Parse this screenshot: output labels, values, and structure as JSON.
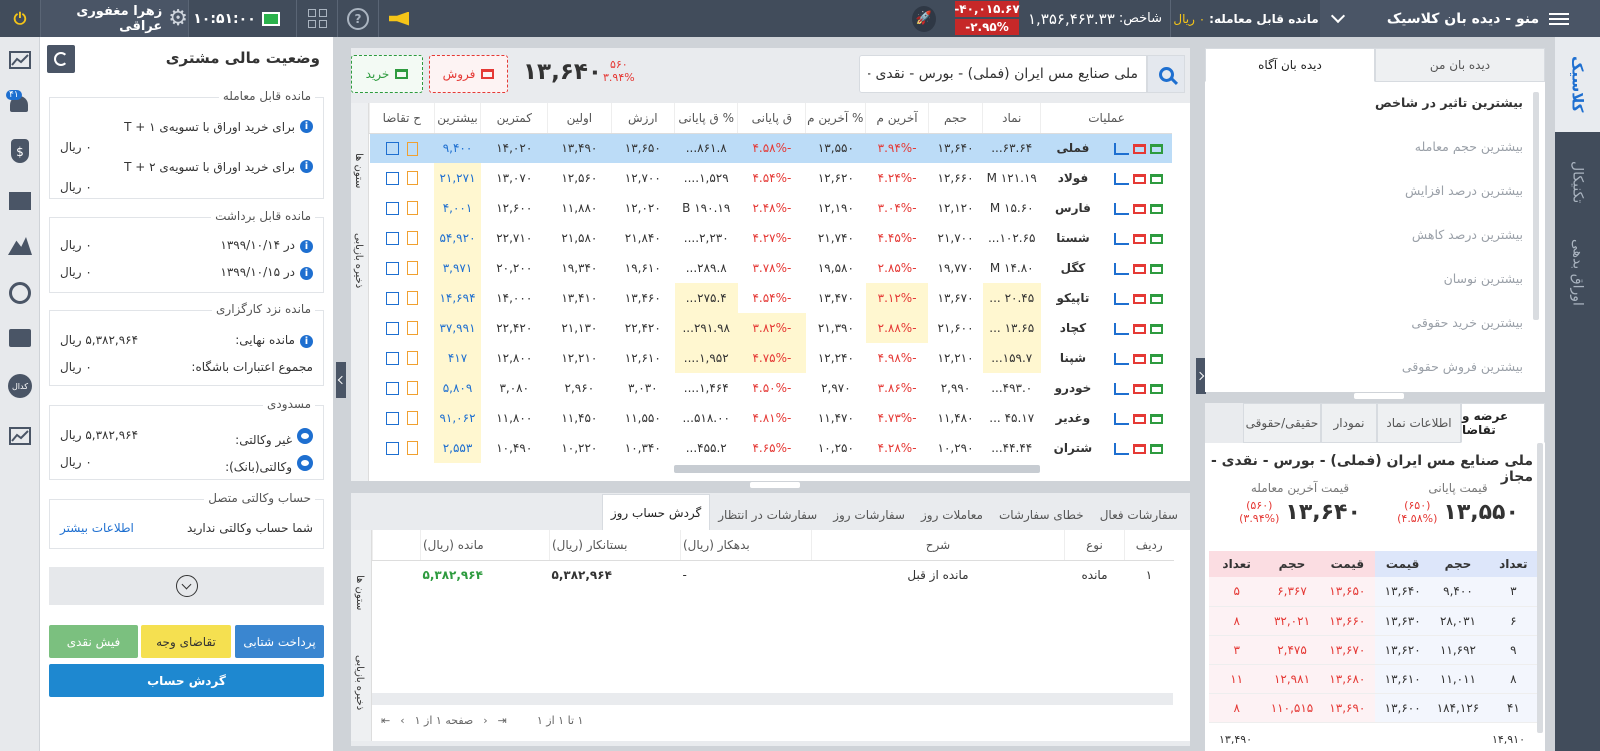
{
  "top": {
    "menu_title": "منو - دیده بان کلاسیک",
    "balance_label": "مانده قابل معامله:",
    "balance_value": "۰ ریال",
    "index_label": "شاخص:",
    "index_value": "۱,۳۵۶,۴۶۳.۳۳",
    "index_change": "-۴۰,۰۱۵.۶۷",
    "index_pct": "-۲.۹۵%",
    "time": "۱۰:۵۱:۰۰",
    "user": "زهرا مغفوری عراقی"
  },
  "right_tabs": [
    "کلاسیک",
    "تکنیکال",
    "اوراق بدهی"
  ],
  "watch": {
    "tabs": [
      "دیده بان من",
      "دیده بان آگاه"
    ],
    "items": [
      "بیشترین تاثیر در شاخص",
      "بیشترین حجم معامله",
      "بیشترین درصد افزایش",
      "بیشترین درصد کاهش",
      "بیشترین نوسان",
      "بیشترین خرید حقوقی",
      "بیشترین فروش حقوقی"
    ]
  },
  "ob": {
    "tabs": [
      "عرضه و تقاضا",
      "اطلاعات نماد",
      "نمودار",
      "حقیقی/حقوقی"
    ],
    "title": "ملی صنایع مس ایران (فملی) - بورس - نقدی - مجاز",
    "last_label": "قیمت آخرین معامله",
    "last_price": "۱۳,۶۴۰",
    "last_change": "(۵۶۰)",
    "last_pct": "(۳.۹۴%)",
    "close_label": "قیمت پایانی",
    "close_price": "۱۳,۵۵۰",
    "close_change": "(۶۵۰)",
    "close_pct": "(۴.۵۸%)",
    "headers": [
      "تعداد",
      "حجم",
      "قیمت",
      "قیمت",
      "حجم",
      "تعداد"
    ],
    "rows": [
      [
        "۳",
        "۹,۴۰۰",
        "۱۳,۶۴۰",
        "۱۳,۶۵۰",
        "۶,۳۶۷",
        "۵"
      ],
      [
        "۶",
        "۲۸,۰۳۱",
        "۱۳,۶۳۰",
        "۱۳,۶۶۰",
        "۳۲,۰۲۱",
        "۸"
      ],
      [
        "۹",
        "۱۱,۶۹۲",
        "۱۳,۶۲۰",
        "۱۳,۶۷۰",
        "۲,۴۷۵",
        "۳"
      ],
      [
        "۸",
        "۱۱,۰۱۱",
        "۱۳,۶۱۰",
        "۱۳,۶۸۰",
        "۱۲,۹۸۱",
        "۱۱"
      ],
      [
        "۴۱",
        "۱۸۴,۱۲۶",
        "۱۳,۶۰۰",
        "۱۳,۶۹۰",
        "۱۱۰,۵۱۵",
        "۸"
      ]
    ],
    "footer_left": "۱۳,۴۹۰",
    "footer_right": "۱۴,۹۱۰"
  },
  "center": {
    "search_value": "ملی صنایع مس ایران (فملی) - بورس - نقدی - مجاز",
    "price": "۱۳,۶۴۰",
    "change": "۵۶۰",
    "pct": "۳.۹۴%",
    "sell": "فروش",
    "buy": "خرید",
    "headers": [
      "عملیات",
      "نماد",
      "حجم",
      "آخرین م",
      "% آخرین م",
      "ق پایانی",
      "% ق پایانی",
      "ارزش",
      "اولین",
      "کمترین",
      "بیشترین",
      "ح تقاضا"
    ],
    "side_labels": [
      "ستون ها",
      "ذخیره بازیابی"
    ],
    "rows": [
      [
        "فملی",
        "۶۳.۶۴...",
        "۱۳,۶۴۰",
        "-۳.۹۴%",
        "۱۳,۵۵۰",
        "-۴.۵۸%",
        "۸۶۱.۸...",
        "۱۳,۶۵۰",
        "۱۳,۴۹۰",
        "۱۴,۰۲۰",
        "۹,۴۰۰"
      ],
      [
        "فولاد",
        "۱۲۱.۱۹ M",
        "۱۲,۶۶۰",
        "-۴.۲۴%",
        "۱۲,۶۲۰",
        "-۴.۵۴%",
        "۱,۵۲۹....",
        "۱۲,۷۰۰",
        "۱۲,۵۶۰",
        "۱۳,۰۷۰",
        "۲۱,۲۷۱"
      ],
      [
        "فارس",
        "۱۵.۶۰ M",
        "۱۲,۱۲۰",
        "-۳.۰۴%",
        "۱۲,۱۹۰",
        "-۲.۴۸%",
        "۱۹۰.۱۹ B",
        "۱۲,۰۲۰",
        "۱۱,۸۸۰",
        "۱۲,۶۰۰",
        "۴,۰۰۱"
      ],
      [
        "شستا",
        "۱۰۲.۶۵...",
        "۲۱,۷۰۰",
        "-۴.۴۵%",
        "۲۱,۷۴۰",
        "-۴.۲۷%",
        "۲,۲۳۰....",
        "۲۱,۸۴۰",
        "۲۱,۵۸۰",
        "۲۲,۷۱۰",
        "۵۴,۹۲۰"
      ],
      [
        "کگل",
        "۱۴.۸۰ M",
        "۱۹,۷۷۰",
        "-۲.۸۵%",
        "۱۹,۵۸۰",
        "-۳.۷۸%",
        "۲۸۹.۸...",
        "۱۹,۶۱۰",
        "۱۹,۳۴۰",
        "۲۰,۲۰۰",
        "۳,۹۷۱"
      ],
      [
        "تاپیکو",
        "۲۰.۴۵ ...",
        "۱۳,۶۷۰",
        "-۳.۱۲%",
        "۱۳,۴۷۰",
        "-۴.۵۴%",
        "۲۷۵.۴...",
        "۱۳,۴۶۰",
        "۱۳,۴۱۰",
        "۱۴,۰۰۰",
        "۱۴,۶۹۴"
      ],
      [
        "کچاد",
        "۱۳.۶۵ ...",
        "۲۱,۶۰۰",
        "-۲.۸۸%",
        "۲۱,۳۹۰",
        "-۳.۸۲%",
        "۲۹۱.۹۸...",
        "۲۲,۴۲۰",
        "۲۱,۱۳۰",
        "۲۲,۴۲۰",
        "۳۷,۹۹۱"
      ],
      [
        "شپنا",
        "۱۵۹.۷...",
        "۱۲,۲۱۰",
        "-۴.۹۸%",
        "۱۲,۲۴۰",
        "-۴.۷۵%",
        "۱,۹۵۲....",
        "۱۲,۶۱۰",
        "۱۲,۲۱۰",
        "۱۲,۸۰۰",
        "۴۱۷"
      ],
      [
        "خودرو",
        "۴۹۳.۰...",
        "۲,۹۹۰",
        "-۳.۸۶%",
        "۲,۹۷۰",
        "-۴.۵۰%",
        "۱,۴۶۴....",
        "۳,۰۳۰",
        "۲,۹۶۰",
        "۳,۰۸۰",
        "۵,۸۰۹"
      ],
      [
        "وغدیر",
        "۴۵.۱۷ ...",
        "۱۱,۴۸۰",
        "-۴.۷۳%",
        "۱۱,۴۷۰",
        "-۴.۸۱%",
        "۵۱۸.۰۰...",
        "۱۱,۵۵۰",
        "۱۱,۴۵۰",
        "۱۱,۸۰۰",
        "۹۱,۰۶۲"
      ],
      [
        "شتران",
        "۴۴.۴۴...",
        "۱۰,۲۹۰",
        "-۴.۲۸%",
        "۱۰,۲۵۰",
        "-۴.۶۵%",
        "۴۵۵.۲...",
        "۱۰,۳۴۰",
        "۱۰,۲۲۰",
        "۱۰,۴۹۰",
        "۲,۵۵۳"
      ]
    ]
  },
  "bottom": {
    "tabs": [
      "سفارشات فعال",
      "خطای سفارشات",
      "معاملات روز",
      "سفارشات روز",
      "سفارشات در انتظار",
      "گردش حساب روز"
    ],
    "headers": [
      "ردیف",
      "نوع",
      "شرح",
      "بدهکار (ریال)",
      "بستانکار (ریال)",
      "مانده (ریال)"
    ],
    "row": [
      "۱",
      "مانده",
      "مانده از قبل",
      "-",
      "۵,۳۸۲,۹۶۴",
      "۵,۳۸۲,۹۶۴"
    ],
    "side_labels": [
      "ستون ها",
      "ذخیره بازیابی"
    ],
    "pager_text": "صفحه ۱ از ۱",
    "range_text": "۱ تا ۱ از ۱"
  },
  "left": {
    "title": "وضعیت مالی مشتری",
    "c1_title": "مانده قابل معامله",
    "c1_r1": "برای خرید اوراق با تسویه‌ی ۱ + T",
    "c1_v1": "۰ ریال",
    "c1_r2": "برای خرید اوراق با تسویه‌ی ۲ + T",
    "c1_v2": "۰ ریال",
    "c2_title": "مانده قابل برداشت",
    "c2_r1": "در ۱۳۹۹/۱۰/۱۴",
    "c2_v1": "۰ ریال",
    "c2_r2": "در ۱۳۹۹/۱۰/۱۵",
    "c2_v2": "۰ ریال",
    "c3_title": "مانده نزد کارگزاری",
    "c3_r1": "مانده نهایی:",
    "c3_v1": "۵,۳۸۲,۹۶۴ ریال",
    "c3_r2": "مجموع اعتبارات باشگاه:",
    "c3_v2": "۰ ریال",
    "c4_title": "مسدودی",
    "c4_r1": "غیر وکالتی:",
    "c4_v1": "۵,۳۸۲,۹۶۴ ریال",
    "c4_r2": "وکالتی(بانک):",
    "c4_v2": "۰ ریال",
    "c5_title": "حساب وکالتی متصل",
    "c5_text": "شما حساب وکالتی ندارید",
    "c5_link": "اطلاعات بیشتر",
    "btn_pay": "پرداخت شتابی",
    "btn_req": "تقاضای وجه",
    "btn_cash": "فیش نقدی",
    "btn_flow": "گردش حساب"
  },
  "rail_badge": "۴۱",
  "rail_label": "کدال"
}
